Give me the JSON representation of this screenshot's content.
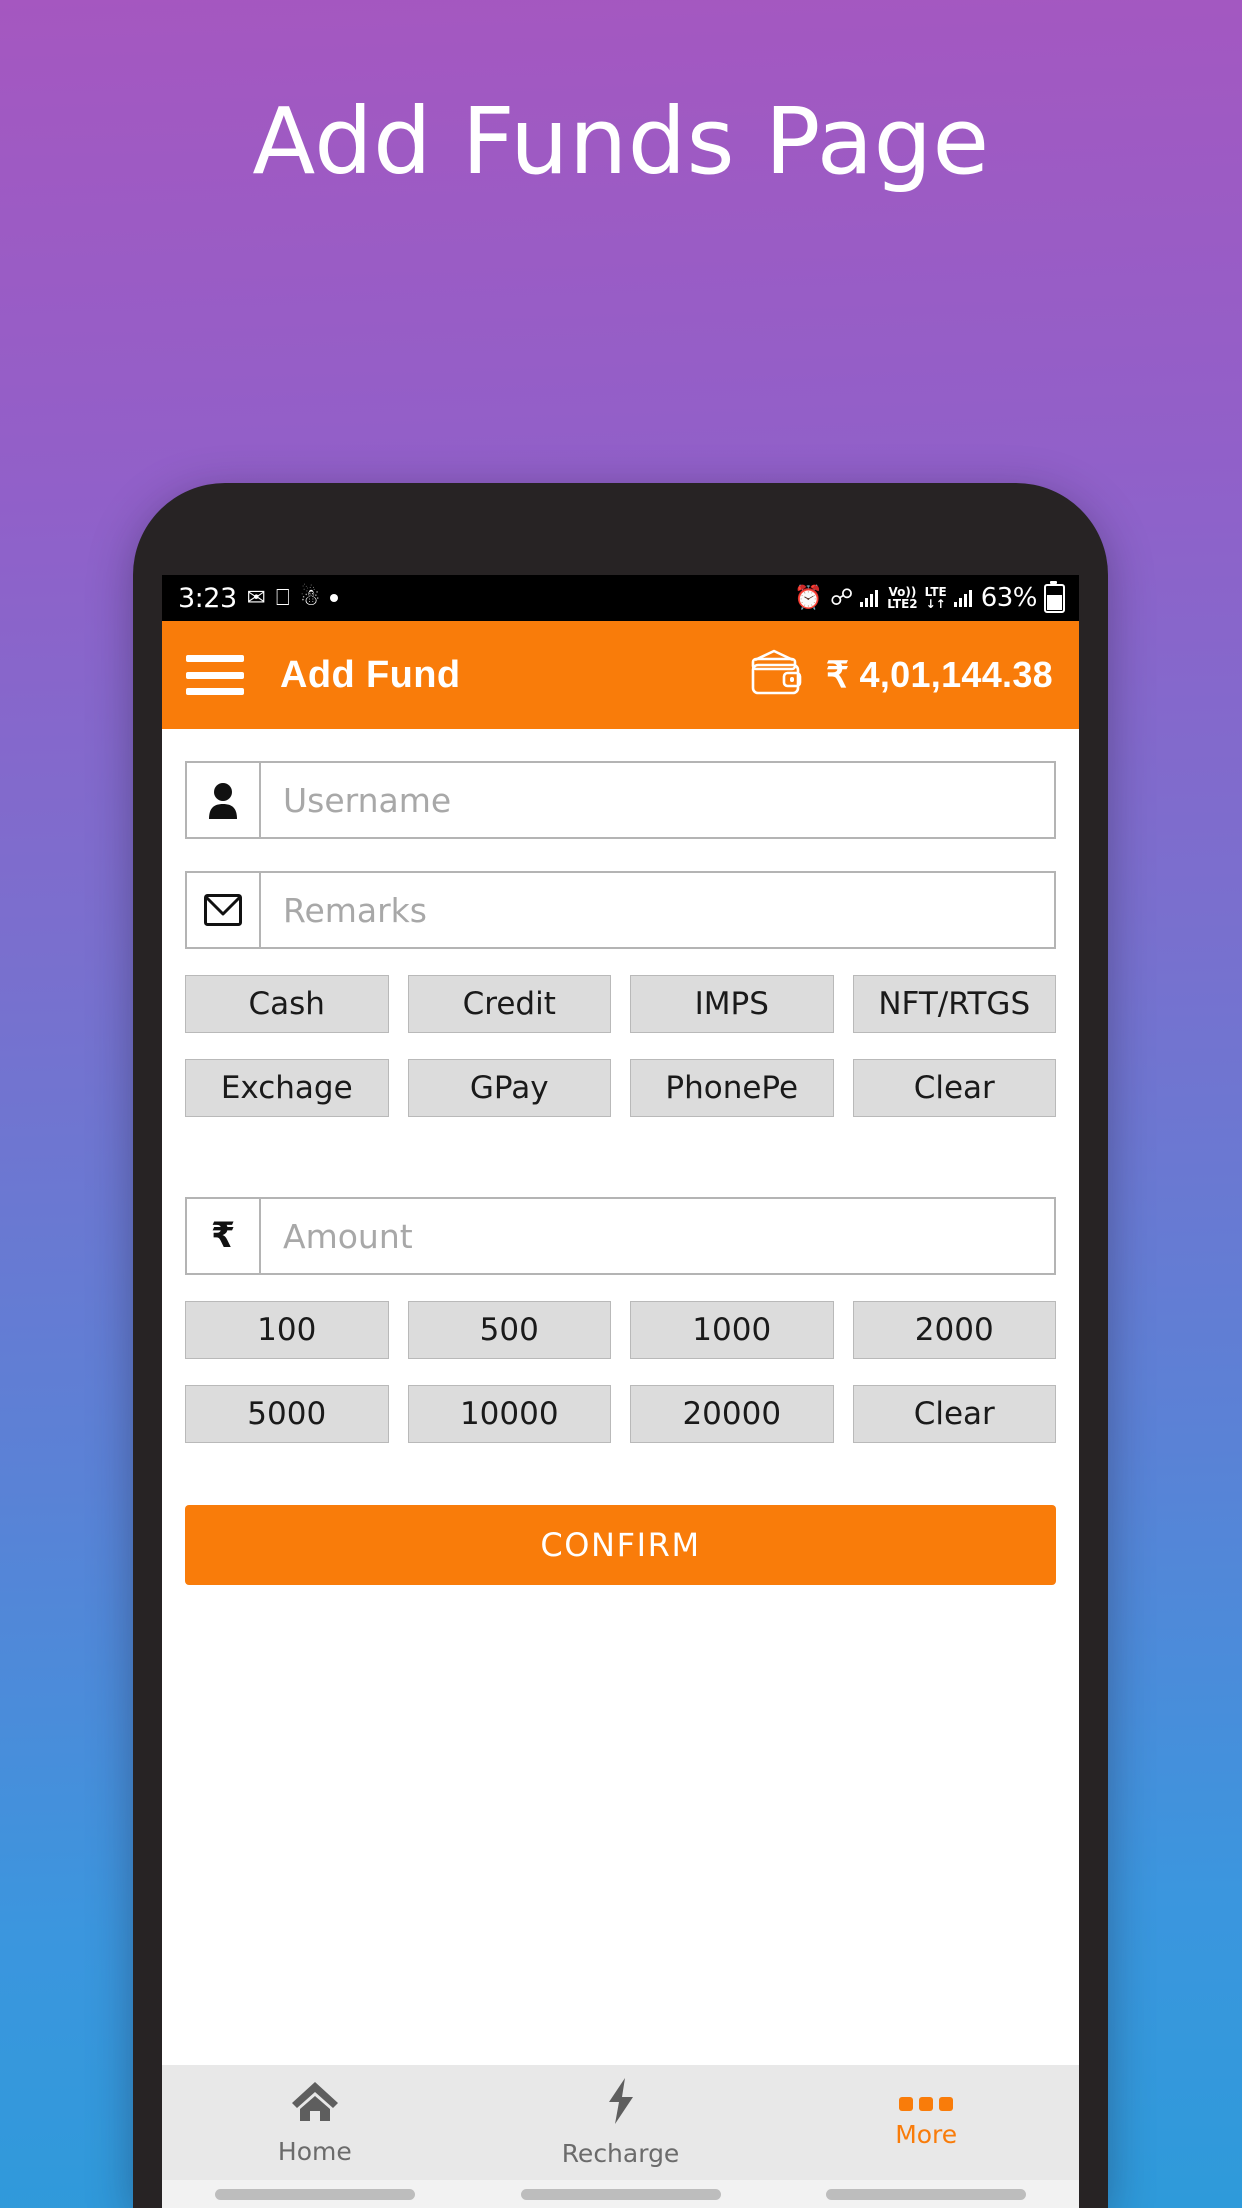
{
  "page": {
    "heading": "Add Funds Page"
  },
  "status_bar": {
    "time": "3:23",
    "left_icons": [
      "whatsapp-icon",
      "laptop-icon",
      "person-pin-icon",
      "dot-icon"
    ],
    "right_icons": [
      "alarm-icon",
      "bluetooth-icon",
      "signal-bars-icon",
      "volte-icon",
      "lte-icon",
      "data-arrows-icon",
      "signal-bars-2-icon"
    ],
    "volte_label": "Vo))",
    "lte2_label": "LTE2",
    "lte_label": "LTE",
    "data_arrows": "↓↑",
    "battery_percent": "63%"
  },
  "app_bar": {
    "menu_icon": "hamburger-icon",
    "title": "Add Fund",
    "wallet_icon": "wallet-icon",
    "currency_symbol": "₹",
    "balance": "4,01,144.38",
    "color": "#F97C0A"
  },
  "form": {
    "username": {
      "icon": "person-icon",
      "placeholder": "Username",
      "value": ""
    },
    "remarks": {
      "icon": "envelope-icon",
      "placeholder": "Remarks",
      "value": ""
    },
    "amount": {
      "icon": "rupee-icon",
      "icon_glyph": "₹",
      "placeholder": "Amount",
      "value": ""
    }
  },
  "payment_methods": {
    "row1": [
      "Cash",
      "Credit",
      "IMPS",
      "NFT/RTGS"
    ],
    "row2": [
      "Exchage",
      "GPay",
      "PhonePe",
      "Clear"
    ]
  },
  "amount_presets": {
    "row1": [
      "100",
      "500",
      "1000",
      "2000"
    ],
    "row2": [
      "5000",
      "10000",
      "20000",
      "Clear"
    ]
  },
  "confirm": {
    "label": "CONFIRM",
    "color": "#F97C0A"
  },
  "bottom_nav": {
    "items": [
      {
        "label": "Home",
        "icon": "home-icon",
        "active": false
      },
      {
        "label": "Recharge",
        "icon": "lightning-bolt-icon",
        "active": false
      },
      {
        "label": "More",
        "icon": "three-dots-icon",
        "active": true
      }
    ],
    "active_color": "#F97C0A",
    "inactive_color": "#6b6b6b"
  },
  "theme": {
    "background_top": "#a557c0",
    "background_bottom": "#2e9ada",
    "accent": "#F97C0A",
    "chip_background": "#DCDCDC"
  }
}
